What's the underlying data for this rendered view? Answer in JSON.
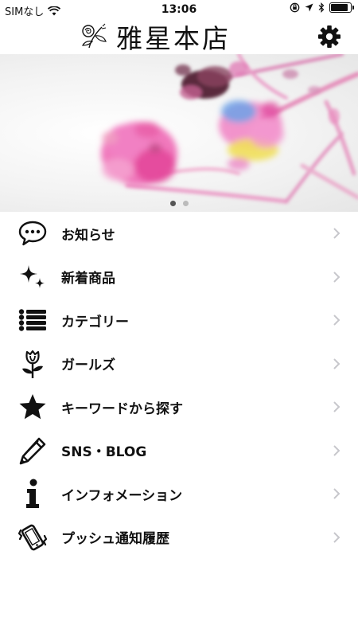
{
  "status_bar": {
    "carrier": "SIMなし",
    "time": "13:06"
  },
  "header": {
    "title": "雅星本店",
    "settings_icon": "gear-icon"
  },
  "carousel": {
    "pages": 2,
    "active_index": 0
  },
  "menu": [
    {
      "label": "お知らせ",
      "icon": "speech-bubble-icon"
    },
    {
      "label": "新着商品",
      "icon": "sparkles-icon"
    },
    {
      "label": "カテゴリー",
      "icon": "list-icon"
    },
    {
      "label": "ガールズ",
      "icon": "rose-icon"
    },
    {
      "label": "キーワードから探す",
      "icon": "star-icon"
    },
    {
      "label": "SNS・BLOG",
      "icon": "pencil-icon"
    },
    {
      "label": "インフォメーション",
      "icon": "info-icon"
    },
    {
      "label": "プッシュ通知履歴",
      "icon": "vibrating-phone-icon"
    }
  ],
  "colors": {
    "background": "#ffffff",
    "text": "#111111",
    "chevron": "#c7c7cc"
  }
}
